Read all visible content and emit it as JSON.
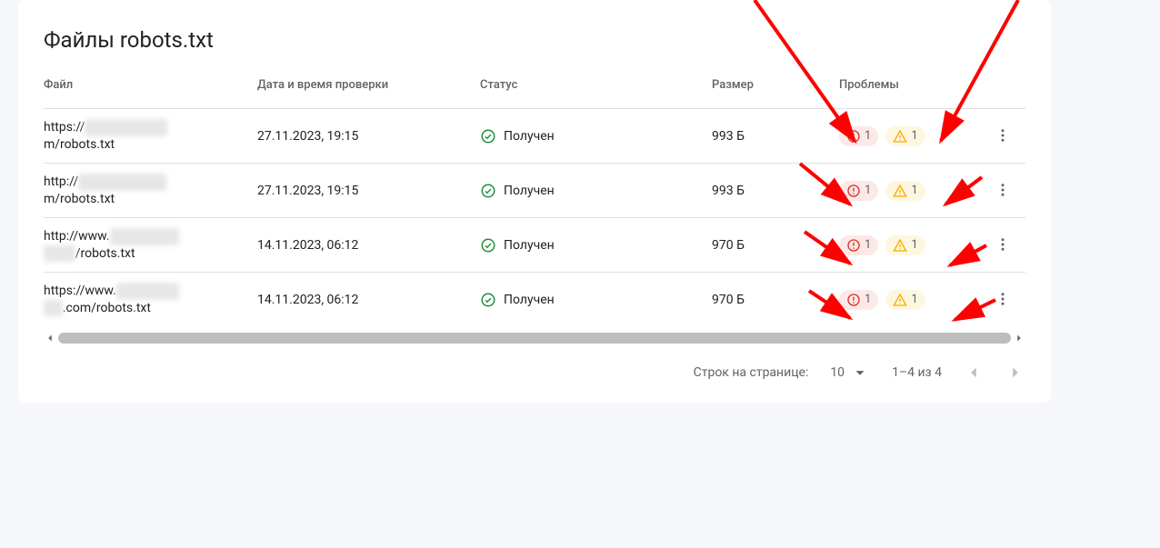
{
  "title": "Файлы robots.txt",
  "columns": {
    "file": "Файл",
    "date": "Дата и время проверки",
    "status": "Статус",
    "size": "Размер",
    "issues": "Проблемы"
  },
  "status_label": "Получен",
  "rows": [
    {
      "url_line1_prefix": "https://",
      "url_line1_blur": "xxxxxxxxxxxxx",
      "url_line2_prefix": "",
      "url_line2_blur": "",
      "url_line2_suffix": "m/robots.txt",
      "date": "27.11.2023, 19:15",
      "status": "Получен",
      "size": "993 Б",
      "errors": "1",
      "warnings": "1"
    },
    {
      "url_line1_prefix": "http://",
      "url_line1_blur": "xxxxxxxxxxxxxx",
      "url_line2_prefix": "",
      "url_line2_blur": "",
      "url_line2_suffix": "m/robots.txt",
      "date": "27.11.2023, 19:15",
      "status": "Получен",
      "size": "993 Б",
      "errors": "1",
      "warnings": "1"
    },
    {
      "url_line1_prefix": "http://www.",
      "url_line1_blur": "xxxxxxxxxxx",
      "url_line2_prefix": "",
      "url_line2_blur": "xxxxx",
      "url_line2_suffix": "/robots.txt",
      "date": "14.11.2023, 06:12",
      "status": "Получен",
      "size": "970 Б",
      "errors": "1",
      "warnings": "1"
    },
    {
      "url_line1_prefix": "https://www.",
      "url_line1_blur": "xxxxxxxxxx",
      "url_line2_prefix": "",
      "url_line2_blur": "xxx",
      "url_line2_suffix": ".com/robots.txt",
      "date": "14.11.2023, 06:12",
      "status": "Получен",
      "size": "970 Б",
      "errors": "1",
      "warnings": "1"
    }
  ],
  "pager": {
    "rows_label": "Строк на странице:",
    "rows_value": "10",
    "range": "1–4 из 4"
  }
}
